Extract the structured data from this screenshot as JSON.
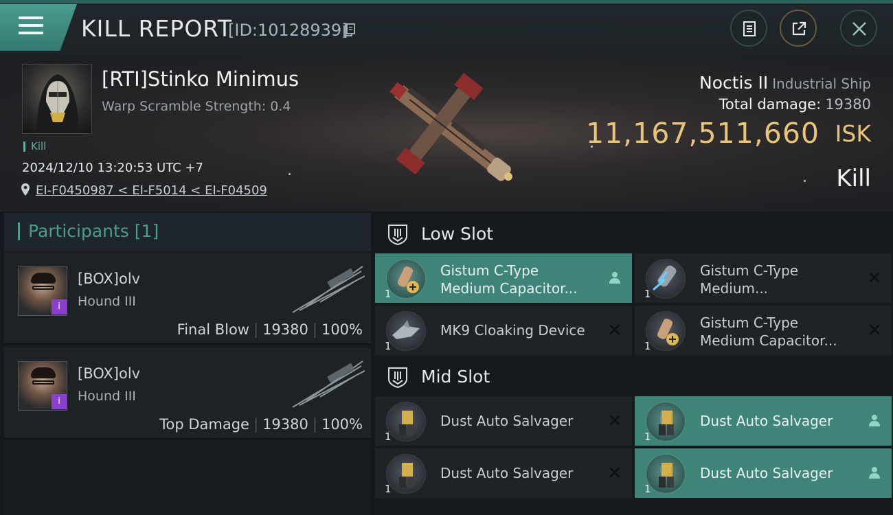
{
  "header": {
    "title": "KILL REPORT",
    "report_id": "[ID:10128939]"
  },
  "victim": {
    "name": "[RTI]Stinko Minimus",
    "warp_scramble": "Warp Scramble Strength: 0.4",
    "kill_tag": "Kill",
    "datetime": "2024/12/10 13:20:53 UTC +7",
    "location": "EI-F0450987 < EI-F5014 < EI-F04509"
  },
  "ship": {
    "name": "Noctis II",
    "class": "Industrial Ship",
    "total_damage_label": "Total damage:",
    "total_damage_value": "19380",
    "isk_value": "11,167,511,660",
    "isk_unit": "ISK",
    "outcome": "Kill"
  },
  "participants": {
    "title": "Participants [1]",
    "rows": [
      {
        "name": "[BOX]olv",
        "ship": "Hound III",
        "role": "Final Blow",
        "damage": "19380",
        "percent": "100%"
      },
      {
        "name": "[BOX]olv",
        "ship": "Hound III",
        "role": "Top Damage",
        "damage": "19380",
        "percent": "100%"
      }
    ]
  },
  "low_slot": {
    "title": "Low Slot",
    "modules": [
      {
        "name_line1": "Gistum C-Type",
        "name_line2": "Medium Capacitor...",
        "qty": "1",
        "status": "dropped"
      },
      {
        "name_line1": "Gistum C-Type",
        "name_line2": "Medium...",
        "qty": "1",
        "status": "destroyed"
      },
      {
        "name_line1": "MK9 Cloaking Device",
        "qty": "1",
        "status": "destroyed"
      },
      {
        "name_line1": "Gistum C-Type",
        "name_line2": "Medium Capacitor...",
        "qty": "1",
        "status": "destroyed"
      }
    ]
  },
  "mid_slot": {
    "title": "Mid Slot",
    "modules": [
      {
        "name_line1": "Dust Auto Salvager",
        "qty": "1",
        "status": "destroyed"
      },
      {
        "name_line1": "Dust Auto Salvager",
        "qty": "1",
        "status": "dropped"
      },
      {
        "name_line1": "Dust Auto Salvager",
        "qty": "1",
        "status": "destroyed"
      },
      {
        "name_line1": "Dust Auto Salvager",
        "qty": "1",
        "status": "dropped"
      }
    ]
  },
  "colors": {
    "accent": "#3e8478",
    "isk": "#e9c57a",
    "purple_badge": "#8a3fd1"
  },
  "icons": {
    "menu": "hamburger-icon",
    "copy": "copy-icon",
    "clipboard": "clipboard-icon",
    "share": "share-icon",
    "close": "close-icon",
    "location": "location-pin-icon",
    "slot": "slot-shield-icon",
    "dropped": "person-icon",
    "destroyed": "x-mark-icon"
  }
}
